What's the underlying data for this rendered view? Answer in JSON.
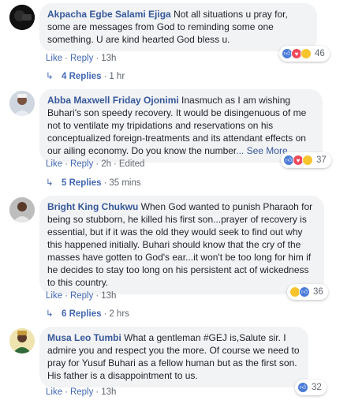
{
  "comments": [
    {
      "author": "Akpacha Egbe Salami Ejiga",
      "text": "Not all situations u pray for, some are messages from God to reminding some one something. U are kind hearted God bless u.",
      "like": "Like",
      "reply": "Reply",
      "time": "13h",
      "edited": "",
      "reaction_count": "46",
      "reactions": [
        "like-icon",
        "love-icon",
        "haha-icon"
      ],
      "replies_label": "4 Replies",
      "replies_time": "1 hr"
    },
    {
      "author": "Abba Maxwell Friday Ojonimi",
      "text": "Inasmuch as I am wishing Buhari's son speedy recovery. It would be disingenuous of me not to ventilate my tripidations and reservations on his conceptualized foreign-treatments and its attendant effects on our ailing economy. Do you know the number",
      "see_more": "... See More",
      "like": "Like",
      "reply": "Reply",
      "time": "2h",
      "edited": "Edited",
      "reaction_count": "37",
      "reactions": [
        "like-icon",
        "love-icon",
        "wow-icon"
      ],
      "replies_label": "5 Replies",
      "replies_time": "35 mins"
    },
    {
      "author": "Bright King Chukwu",
      "text": "When God wanted to punish Pharaoh for being so stubborn, he killed his first son...prayer of recovery is essential, but if it was the old they would seek to find out why this happened initially. Buhari should know that the cry of the masses have gotten to God's ear...it won't be too long for him if he decides to stay too long on his persistent act of wickedness to this country.",
      "like": "Like",
      "reply": "Reply",
      "time": "13h",
      "edited": "",
      "reaction_count": "36",
      "reactions": [
        "haha-icon",
        "like-icon"
      ],
      "replies_label": "6 Replies",
      "replies_time": "2 hrs"
    },
    {
      "author": "Musa Leo Tumbi",
      "text": "What a gentleman #GEJ is,Salute sir. I admire you and respect you the more. Of course we need to pray for Yusuf Buhari as a fellow human but as the first son. His father is a disappointment to us.",
      "like": "Like",
      "reply": "Reply",
      "time": "13h",
      "edited": "",
      "reaction_count": "32",
      "reactions": [
        "like-icon"
      ]
    }
  ],
  "colors": {
    "link": "#365899",
    "action": "#4267b2",
    "bubble": "#f2f3f5",
    "like": "#4a7bd8",
    "love": "#ef4a5c",
    "haha": "#f7c42e"
  }
}
